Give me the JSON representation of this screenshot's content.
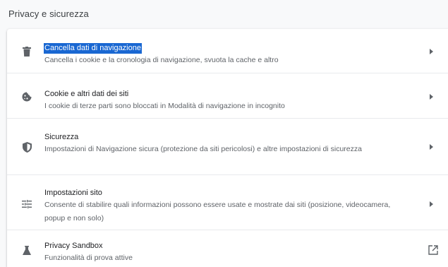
{
  "section": {
    "title": "Privacy e sicurezza"
  },
  "rows": [
    {
      "name": "clear-browsing-data",
      "icon": "trash-icon",
      "title": "Cancella dati di navigazione",
      "subtitle": "Cancella i cookie e la cronologia di navigazione, svuota la cache e altro",
      "action": "arrow-right-icon",
      "selected": true
    },
    {
      "name": "cookies",
      "icon": "cookie-icon",
      "title": "Cookie e altri dati dei siti",
      "subtitle": "I cookie di terze parti sono bloccati in Modalità di navigazione in incognito",
      "action": "arrow-right-icon"
    },
    {
      "name": "security",
      "icon": "shield-icon",
      "title": "Sicurezza",
      "subtitle": "Impostazioni di Navigazione sicura (protezione da siti pericolosi) e altre impostazioni di sicurezza",
      "action": "arrow-right-icon"
    },
    {
      "name": "site-settings",
      "icon": "sliders-icon",
      "title": "Impostazioni sito",
      "subtitle": "Consente di stabilire quali informazioni possono essere usate e mostrate dai siti (posizione, videocamera, popup e non solo)",
      "action": "arrow-right-icon"
    },
    {
      "name": "privacy-sandbox",
      "icon": "flask-icon",
      "title": "Privacy Sandbox",
      "subtitle": "Funzionalità di prova attive",
      "action": "open-in-new-icon"
    }
  ],
  "colors": {
    "selection": "#1967d2",
    "text_primary": "#202124",
    "text_secondary": "#5f6368",
    "icon": "#5f6368"
  }
}
